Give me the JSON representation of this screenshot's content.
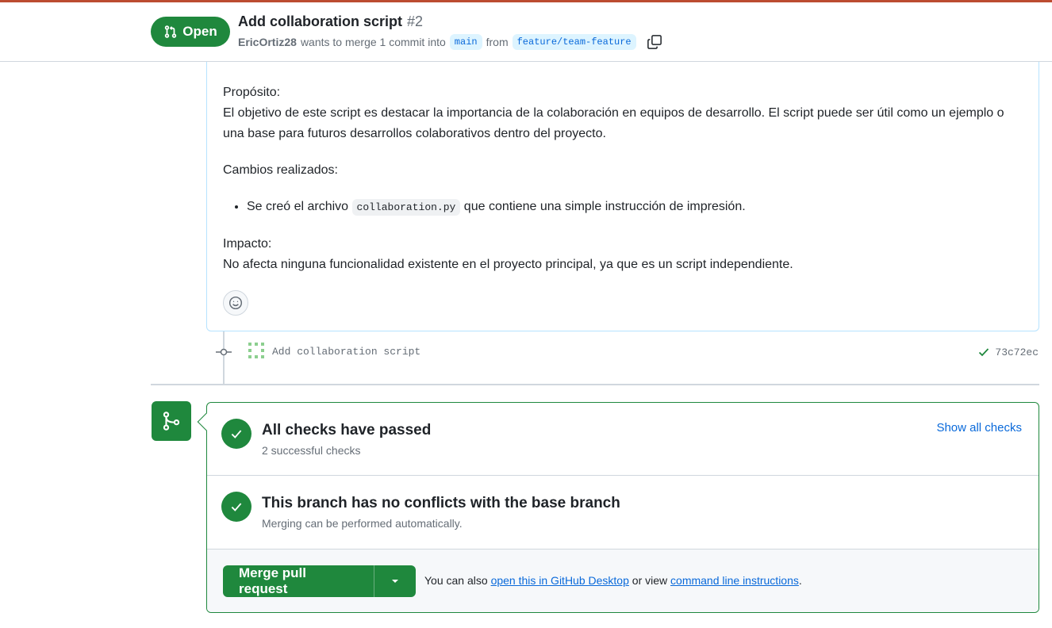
{
  "header": {
    "state_label": "Open",
    "title": "Add collaboration script",
    "number": "#2",
    "author": "EricOrtiz28",
    "meta_text": "wants to merge 1 commit into",
    "base_branch": "main",
    "from_text": "from",
    "head_branch": "feature/team-feature"
  },
  "comment": {
    "purpose_heading": "Propósito:",
    "purpose_text": "El objetivo de este script es destacar la importancia de la colaboración en equipos de desarrollo. El script puede ser útil como un ejemplo o una base para futuros desarrollos colaborativos dentro del proyecto.",
    "changes_heading": "Cambios realizados:",
    "change_item_prefix": "Se creó el archivo",
    "change_item_code": "collaboration.py",
    "change_item_suffix": "que contiene una simple instrucción de impresión.",
    "impact_heading": "Impacto:",
    "impact_text": "No afecta ninguna funcionalidad existente en el proyecto principal, ya que es un script independiente."
  },
  "timeline": {
    "commit_message": "Add collaboration script",
    "commit_sha": "73c72ec"
  },
  "merge_box": {
    "checks_title": "All checks have passed",
    "checks_sub": "2 successful checks",
    "show_checks": "Show all checks",
    "conflicts_title": "This branch has no conflicts with the base branch",
    "conflicts_sub": "Merging can be performed automatically.",
    "merge_button": "Merge pull request",
    "hint_prefix": "You can also",
    "hint_link1": "open this in GitHub Desktop",
    "hint_mid": "or view",
    "hint_link2": "command line instructions",
    "hint_suffix": "."
  },
  "colors": {
    "success": "#1f883d",
    "link": "#0969da",
    "muted": "#656d76",
    "accent_top": "#bc4c31"
  }
}
